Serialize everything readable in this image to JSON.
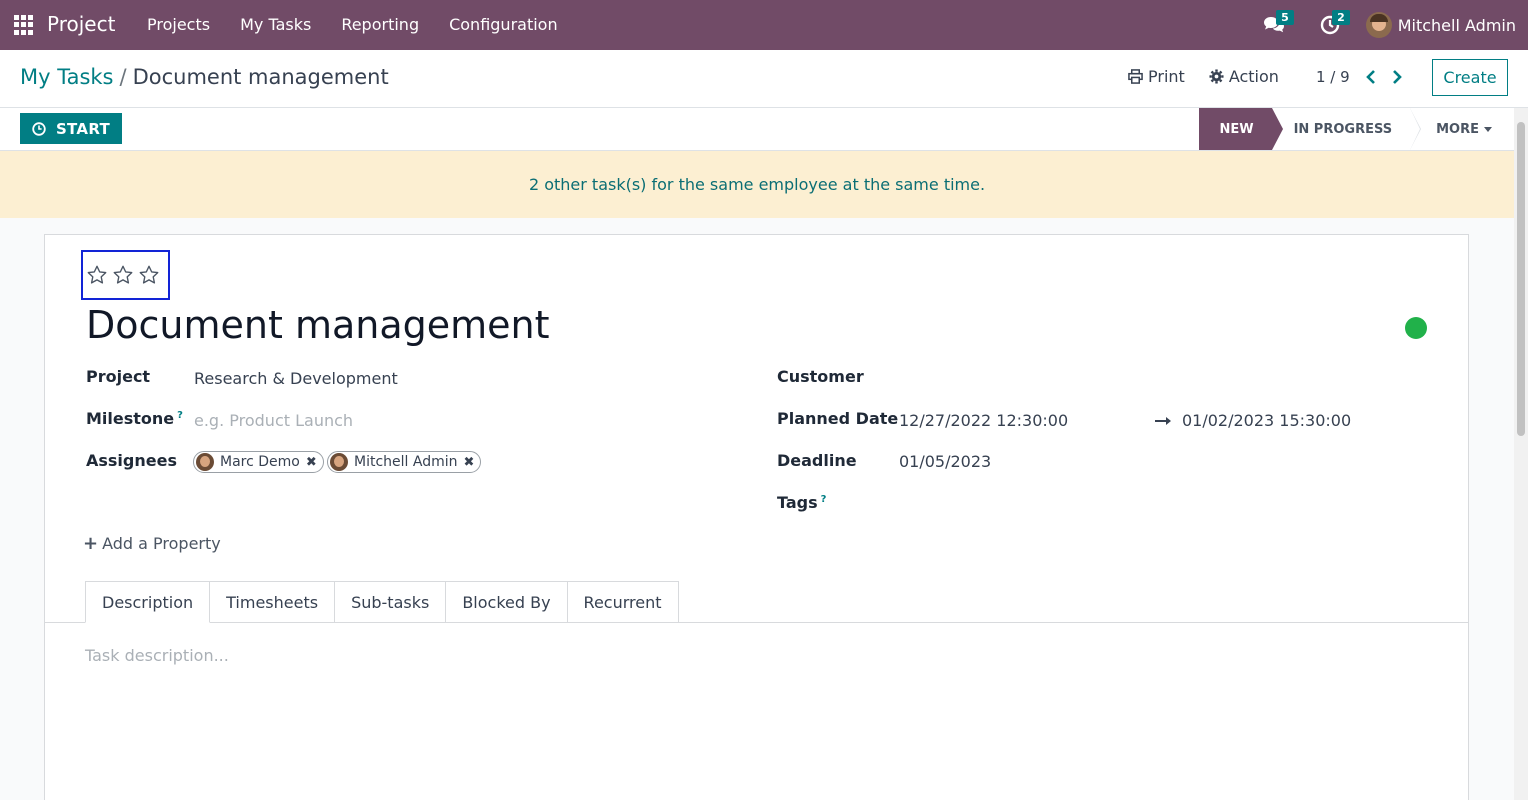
{
  "navbar": {
    "app_name": "Project",
    "menu": [
      "Projects",
      "My Tasks",
      "Reporting",
      "Configuration"
    ],
    "messages_count": "5",
    "activities_count": "2",
    "user_name": "Mitchell Admin",
    "color": "#714b67"
  },
  "breadcrumb": {
    "parent": "My Tasks",
    "separator": "/",
    "current": "Document management"
  },
  "control_panel": {
    "print_label": "Print",
    "action_label": "Action",
    "pager": "1 / 9",
    "create_label": "Create"
  },
  "statusbar": {
    "start_label": "START",
    "stages": [
      "NEW",
      "IN PROGRESS",
      "MORE"
    ],
    "active_stage": "NEW"
  },
  "alert": {
    "text": "2 other task(s) for the same employee at the same time.",
    "color": "#fcefd2"
  },
  "task": {
    "priority_stars": 0,
    "priority_max": 3,
    "title": "Document management",
    "kanban_state_color": "#21b14a",
    "fields": {
      "project_label": "Project",
      "project_value": "Research & Development",
      "milestone_label": "Milestone",
      "milestone_help": "?",
      "milestone_placeholder": "e.g. Product Launch",
      "assignees_label": "Assignees",
      "assignees": [
        "Marc Demo",
        "Mitchell Admin"
      ],
      "customer_label": "Customer",
      "planned_date_label": "Planned Date",
      "planned_start": "12/27/2022 12:30:00",
      "planned_end": "01/02/2023 15:30:00",
      "deadline_label": "Deadline",
      "deadline_value": "01/05/2023",
      "tags_label": "Tags",
      "tags_help": "?"
    },
    "add_property_label": "Add a Property",
    "tabs": [
      "Description",
      "Timesheets",
      "Sub-tasks",
      "Blocked By",
      "Recurrent"
    ],
    "description_placeholder": "Task description..."
  },
  "accent_color": "#017e84"
}
